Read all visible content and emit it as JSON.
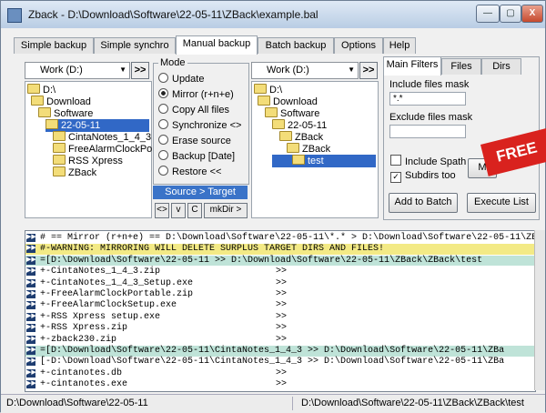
{
  "window": {
    "title": "Zback - D:\\Download\\Software\\22-05-11\\ZBack\\example.bal",
    "minimize": "—",
    "maximize": "▢",
    "close": "X"
  },
  "tabs": [
    "Simple backup",
    "Simple synchro",
    "Manual backup",
    "Batch backup",
    "Options",
    "Help"
  ],
  "active_tab": "Manual backup",
  "source": {
    "drive": "Work (D:)",
    "go_label": ">>",
    "tree": [
      "D:\\",
      "Download",
      "Software",
      "22-05-11",
      "CintaNotes_1_4_3",
      "FreeAlarmClockPorte",
      "RSS Xpress",
      "ZBack"
    ],
    "selected": "22-05-11"
  },
  "mode": {
    "label": "Mode",
    "options": [
      "Update",
      "Mirror (r+n+e)",
      "Copy All files",
      "Synchronize <>",
      "Erase source",
      "Backup [Date]",
      "Restore <<"
    ],
    "selected": "Mirror (r+n+e)",
    "direction": "Source > Target",
    "buttons": [
      "<>",
      "v",
      "C",
      "mkDir >"
    ]
  },
  "target": {
    "drive": "Work (D:)",
    "go_label": ">>",
    "tree": [
      "D:\\",
      "Download",
      "Software",
      "22-05-11",
      "ZBack",
      "ZBack",
      "test"
    ],
    "selected": "test"
  },
  "filters": {
    "tabs": [
      "Main Filters",
      "Files",
      "Dirs"
    ],
    "include_label": "Include files mask",
    "include_value": "*.*",
    "exclude_label": "Exclude files mask",
    "exclude_value": "",
    "include_spath": "Include Spath",
    "subdirs_too": "Subdirs too",
    "partial_button": "M",
    "add_batch": "Add to Batch",
    "execute_list": "Execute List",
    "badge": "FREE"
  },
  "log": [
    {
      "text": "# == Mirror (r+n+e) == D:\\Download\\Software\\22-05-11\\*.* > D:\\Download\\Software\\22-05-11\\ZBa",
      "dst": "",
      "bg": "#ffffff"
    },
    {
      "text": "#-WARNING: MIRRORING WILL DELETE SURPLUS TARGET DIRS AND FILES!",
      "dst": "",
      "bg": "#f3ea86"
    },
    {
      "text": "=[D:\\Download\\Software\\22-05-11 >> D:\\Download\\Software\\22-05-11\\ZBack\\ZBack\\test",
      "dst": "",
      "bg": "#bfe3d8"
    },
    {
      "text": "+-CintaNotes_1_4_3.zip",
      "dst": ">>",
      "bg": "#ffffff"
    },
    {
      "text": "+-CintaNotes_1_4_3_Setup.exe",
      "dst": ">>",
      "bg": "#ffffff"
    },
    {
      "text": "+-FreeAlarmClockPortable.zip",
      "dst": ">>",
      "bg": "#ffffff"
    },
    {
      "text": "+-FreeAlarmClockSetup.exe",
      "dst": ">>",
      "bg": "#ffffff"
    },
    {
      "text": "+-RSS Xpress setup.exe",
      "dst": ">>",
      "bg": "#ffffff"
    },
    {
      "text": "+-RSS Xpress.zip",
      "dst": ">>",
      "bg": "#ffffff"
    },
    {
      "text": "+-zback230.zip",
      "dst": ">>",
      "bg": "#ffffff"
    },
    {
      "text": "=[D:\\Download\\Software\\22-05-11\\CintaNotes_1_4_3 >> D:\\Download\\Software\\22-05-11\\ZBa",
      "dst": "",
      "bg": "#bfe3d8"
    },
    {
      "text": "[-D:\\Download\\Software\\22-05-11\\CintaNotes_1_4_3 >> D:\\Download\\Software\\22-05-11\\ZBa",
      "dst": "",
      "bg": "#ffffff"
    },
    {
      "text": "+-cintanotes.db",
      "dst": ">>",
      "bg": "#ffffff"
    },
    {
      "text": "+-cintanotes.exe",
      "dst": ">>",
      "bg": "#ffffff"
    }
  ],
  "status": {
    "left": "D:\\Download\\Software\\22-05-11",
    "right": "D:\\Download\\Software\\22-05-11\\ZBack\\ZBack\\test"
  }
}
